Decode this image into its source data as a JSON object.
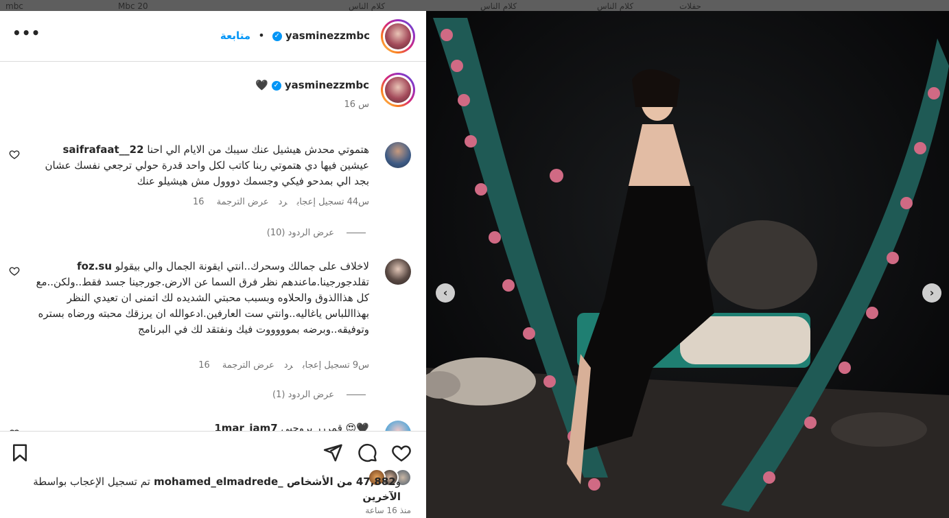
{
  "background_tabs": [
    "mbc",
    "Mbc 20",
    "كلام الناس",
    "كلام الناس",
    "كلام الناس",
    "حفلات"
  ],
  "post": {
    "author": "yasminezzmbc",
    "follow_label": "متابعة",
    "separator": "•",
    "caption_emoji": "🖤",
    "caption_time": "16 س"
  },
  "comments": [
    {
      "user": "saifrafaat__22",
      "text": "هتموتي محدش هيشيل عنك سيبك من الايام الي احنا عيشين فيها دي هتموتي ربنا كاتب لكل واحد قدرة حولي ترجعي نفسك عشان بجد الي بمدحو فيكي وجسمك دووول مش هيشيلو عنك",
      "time": "16 س",
      "likes": "44 تسجيل إعجاب",
      "reply": "رد",
      "translate": "عرض الترجمة",
      "view_replies": "عرض الردود (10)"
    },
    {
      "user": "foz.su",
      "text": "لاخلاف على جمالك وسحرك..انتي ايقونة الجمال والي بيقولو تقلدجورجينا.ماعندهم نظر فرق السما عن الارض.جورجينا جسد فقط..ولكن..مع كل هذاالذوق والحلاوه وبسبب محبتي الشديده لك اتمنى ان تعيدي النظر بهذااللباس ياغاليه..وانتي ست العارفين.ادعوالله ان يرزقك محبته ورضاه بستره وتوفيقه..وبرضه بموووووت فيك ونفتقد لك في البرنامج",
      "time": "16 س",
      "likes": "9 تسجيل إعجاب",
      "reply": "رد",
      "translate": "عرض الترجمة",
      "view_replies": "عرض الردود (1)"
    },
    {
      "user": "1mar_iam7",
      "text": "قمررر يروحيي 😍🖤"
    }
  ],
  "likes_summary": {
    "prefix": "تم تسجيل الإعجاب بواسطة",
    "user": "mohamed_elmadrede_",
    "conjunction": "و",
    "count": "47,882",
    "suffix": "من الأشخاص الآخرين"
  },
  "post_time": "منذ 16 ساعة",
  "colors": {
    "link_blue": "#0095f6",
    "text_dark": "#262626",
    "text_muted": "#737373",
    "divider": "#dbdbdb"
  },
  "icons": [
    "more-options-icon",
    "verified-badge-icon",
    "heart-icon",
    "send-icon",
    "comment-icon",
    "like-icon",
    "save-icon",
    "chevron-left-icon",
    "chevron-right-icon"
  ]
}
